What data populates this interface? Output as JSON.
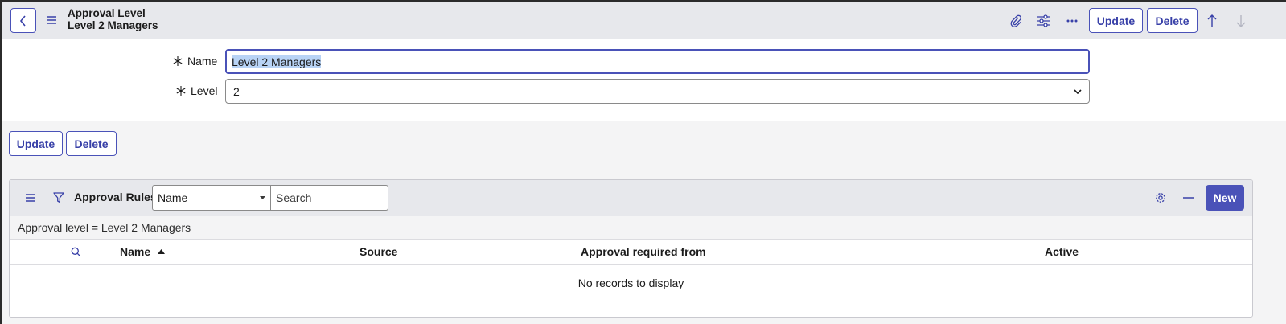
{
  "header": {
    "title_line1": "Approval Level",
    "title_line2": "Level 2 Managers",
    "update_label": "Update",
    "delete_label": "Delete",
    "icons": [
      "back-icon",
      "menu-icon",
      "paperclip-icon",
      "settings-sliders-icon",
      "more-icon",
      "arrow-up-icon",
      "arrow-down-icon"
    ]
  },
  "form": {
    "name_label": "Name",
    "name_value": "Level 2 Managers",
    "level_label": "Level",
    "level_value": "2"
  },
  "actions": {
    "update_label": "Update",
    "delete_label": "Delete"
  },
  "related_list": {
    "title": "Approval Rules",
    "field_select_value": "Name",
    "search_placeholder": "Search",
    "new_label": "New",
    "filter_text": "Approval level = Level 2 Managers",
    "columns": [
      "Name",
      "Source",
      "Approval required from",
      "Active"
    ],
    "empty_message": "No records to display"
  },
  "colors": {
    "accent": "#4a52b8",
    "header_bg": "#e7e8ec",
    "section_bg": "#f4f4f5",
    "selection": "#b8d3f5"
  }
}
